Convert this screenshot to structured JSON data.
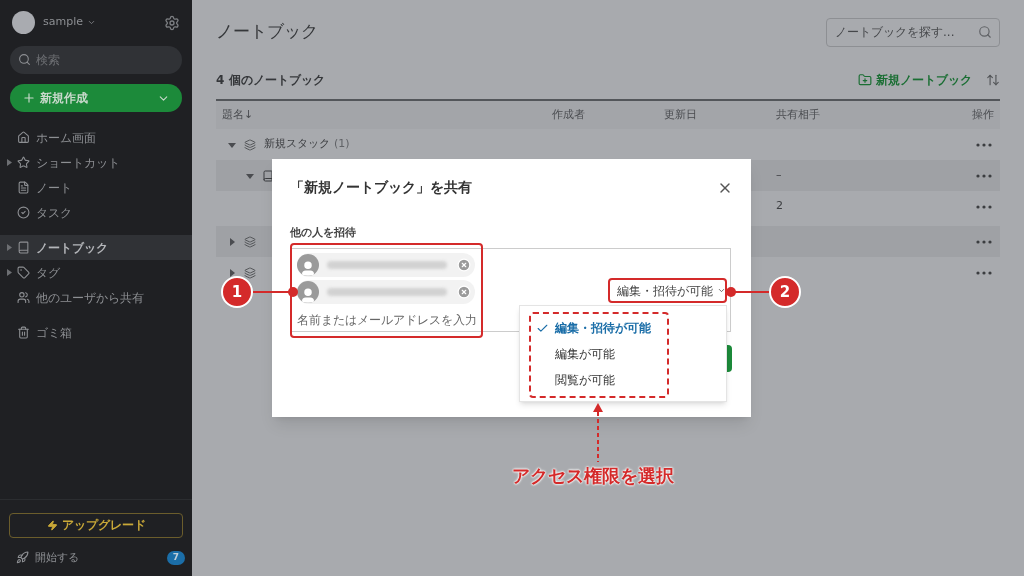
{
  "sidebar": {
    "account": {
      "name": "sample"
    },
    "search": {
      "placeholder": "検索"
    },
    "new_button": {
      "label": "新規作成"
    },
    "nav": [
      {
        "label": "ホーム画面",
        "selected": false
      },
      {
        "label": "ショートカット",
        "selected": false,
        "expanded": false
      },
      {
        "label": "ノート",
        "selected": false
      },
      {
        "label": "タスク",
        "selected": false
      },
      {
        "label": "ノートブック",
        "selected": true,
        "expanded": false
      },
      {
        "label": "タグ",
        "selected": false,
        "expanded": false
      },
      {
        "label": "他のユーザから共有",
        "selected": false
      },
      {
        "label": "ゴミ箱",
        "selected": false
      }
    ],
    "upgrade": {
      "label": "アップグレード"
    },
    "get_started": {
      "label": "開始する",
      "badge": "7"
    }
  },
  "main": {
    "title": "ノートブック",
    "search": {
      "placeholder": "ノートブックを探す..."
    },
    "count_label": "4 個のノートブック",
    "new_notebook": {
      "label": "新規ノートブック"
    },
    "table": {
      "columns": [
        "題名↓",
        "作成者",
        "更新日",
        "共有相手",
        "操作"
      ],
      "rows": [
        {
          "kind": "stack",
          "title": "新規スタック",
          "count": "(1)",
          "expanded": true
        },
        {
          "kind": "notebook",
          "expanded": true,
          "sharing": "–"
        },
        {
          "kind": "notebook",
          "sharing": "2"
        },
        {
          "kind": "stack",
          "expanded": false
        },
        {
          "kind": "stack",
          "expanded": false
        }
      ]
    }
  },
  "dialog": {
    "title": "「新規ノートブック」を共有",
    "invite_label": "他の人を招待",
    "invitees": [
      {
        "kind": "contact"
      },
      {
        "kind": "contact"
      }
    ],
    "placeholder": "名前またはメールアドレスを入力",
    "permission": "編集・招待が可能",
    "menu": [
      {
        "label": "編集・招待が可能",
        "selected": true
      },
      {
        "label": "編集が可能",
        "selected": false
      },
      {
        "label": "閲覧が可能",
        "selected": false
      }
    ]
  },
  "annotations": {
    "callouts": [
      "1",
      "2"
    ],
    "caption": "アクセス権限を選択"
  }
}
